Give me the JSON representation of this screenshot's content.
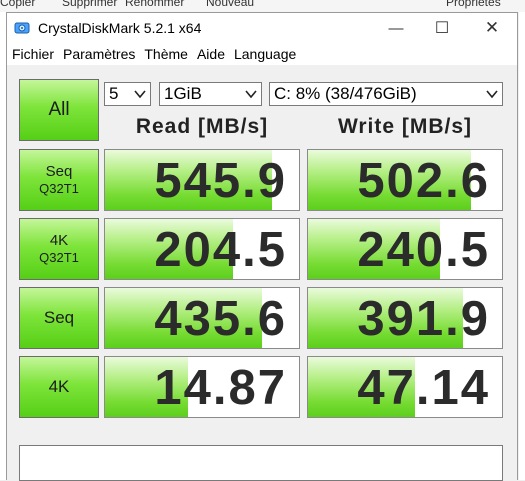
{
  "background": {
    "toolbar_labels": [
      "Copier",
      "Supprimer",
      "Renommer",
      "Nouveau",
      "Propriétés"
    ]
  },
  "window": {
    "title": "CrystalDiskMark 5.2.1 x64",
    "minimize": "—",
    "maximize": "☐",
    "close": "✕"
  },
  "menu": [
    "Fichier",
    "Paramètres",
    "Thème",
    "Aide",
    "Language"
  ],
  "controls": {
    "all_label": "All",
    "count": "5",
    "size": "1GiB",
    "drive": "C: 8% (38/476GiB)"
  },
  "headers": {
    "read": "Read [MB/s]",
    "write": "Write [MB/s]"
  },
  "rows": [
    {
      "label1": "Seq",
      "label2": "Q32T1",
      "read": "545.9",
      "write": "502.6",
      "read_fill": 0.86,
      "write_fill": 0.84
    },
    {
      "label1": "4K",
      "label2": "Q32T1",
      "read": "204.5",
      "write": "240.5",
      "read_fill": 0.66,
      "write_fill": 0.68
    },
    {
      "label1": "Seq",
      "label2": "",
      "read": "435.6",
      "write": "391.9",
      "read_fill": 0.81,
      "write_fill": 0.8
    },
    {
      "label1": "4K",
      "label2": "",
      "read": "14.87",
      "write": "47.14",
      "read_fill": 0.43,
      "write_fill": 0.55
    }
  ],
  "comment": ""
}
